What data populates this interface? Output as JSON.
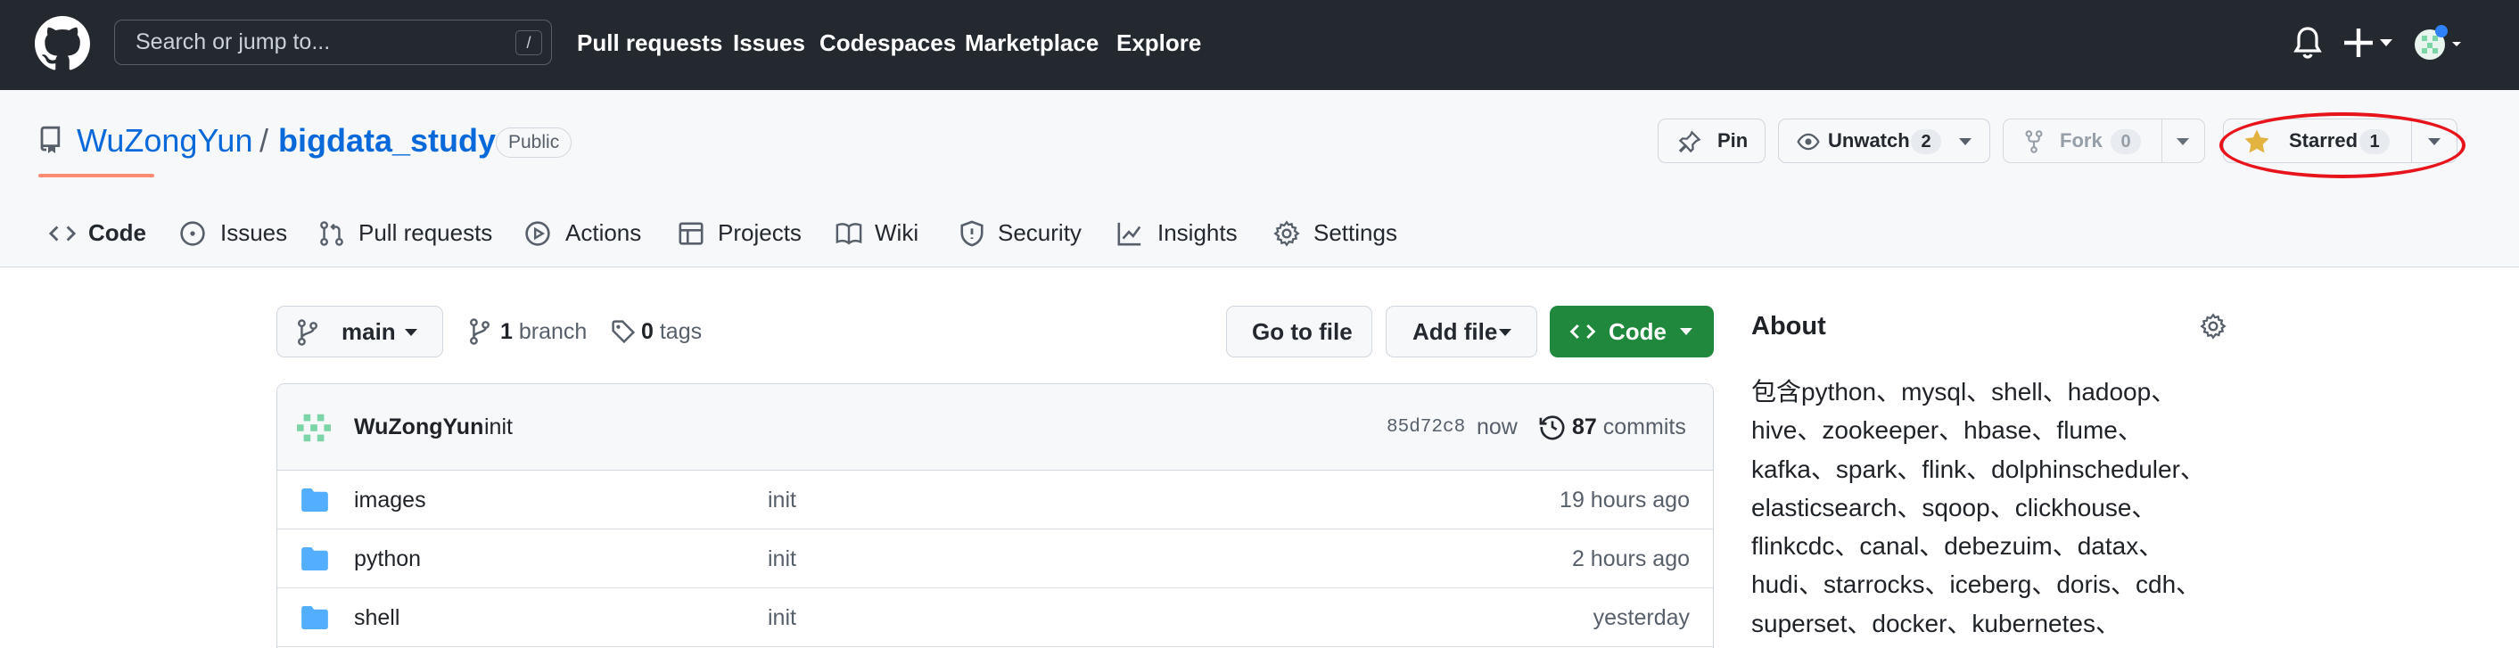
{
  "header": {
    "search_placeholder": "Search or jump to...",
    "search_shortcut": "/",
    "nav": [
      "Pull requests",
      "Issues",
      "Codespaces",
      "Marketplace",
      "Explore"
    ]
  },
  "repo": {
    "owner": "WuZongYun",
    "separator": "/",
    "name": "bigdata_study",
    "visibility": "Public",
    "actions": {
      "pin": "Pin",
      "watch_label": "Unwatch",
      "watch_count": "2",
      "fork_label": "Fork",
      "fork_count": "0",
      "star_label": "Starred",
      "star_count": "1"
    },
    "tabs": [
      "Code",
      "Issues",
      "Pull requests",
      "Actions",
      "Projects",
      "Wiki",
      "Security",
      "Insights",
      "Settings"
    ]
  },
  "filenav": {
    "branch": "main",
    "branch_count": "1",
    "branch_word": "branch",
    "tag_count": "0",
    "tag_word": "tags",
    "go_to_file": "Go to file",
    "add_file": "Add file",
    "code": "Code"
  },
  "latest_commit": {
    "author": "WuZongYun",
    "message": "init",
    "sha": "85d72c8",
    "age": "now",
    "commit_count": "87",
    "commit_word": "commits"
  },
  "files": [
    {
      "name": "images",
      "message": "init",
      "age": "19 hours ago"
    },
    {
      "name": "python",
      "message": "init",
      "age": "2 hours ago"
    },
    {
      "name": "shell",
      "message": "init",
      "age": "yesterday"
    }
  ],
  "about": {
    "title": "About",
    "description_lines": [
      "包含python、mysql、shell、hadoop、",
      "hive、zookeeper、hbase、flume、",
      "kafka、spark、flink、dolphinscheduler、",
      "elasticsearch、sqoop、clickhouse、",
      "flinkcdc、canal、debezuim、datax、",
      "hudi、starrocks、iceberg、doris、cdh、",
      "superset、docker、kubernetes、"
    ]
  },
  "colors": {
    "header_bg": "#24292f",
    "link": "#0969da",
    "primary_button": "#1f883d",
    "active_tab_underline": "#fd8c73",
    "annotation_circle": "#e8141b",
    "star": "#e3b341",
    "folder": "#54aeff"
  },
  "icons": [
    "github-logo-icon",
    "bell-icon",
    "plus-icon",
    "repo-icon",
    "pin-icon",
    "eye-icon",
    "fork-icon",
    "star-icon",
    "code-icon",
    "issue-icon",
    "pull-request-icon",
    "play-icon",
    "table-icon",
    "book-icon",
    "shield-icon",
    "graph-icon",
    "gear-icon",
    "branch-icon",
    "tag-icon",
    "history-icon",
    "folder-icon"
  ]
}
